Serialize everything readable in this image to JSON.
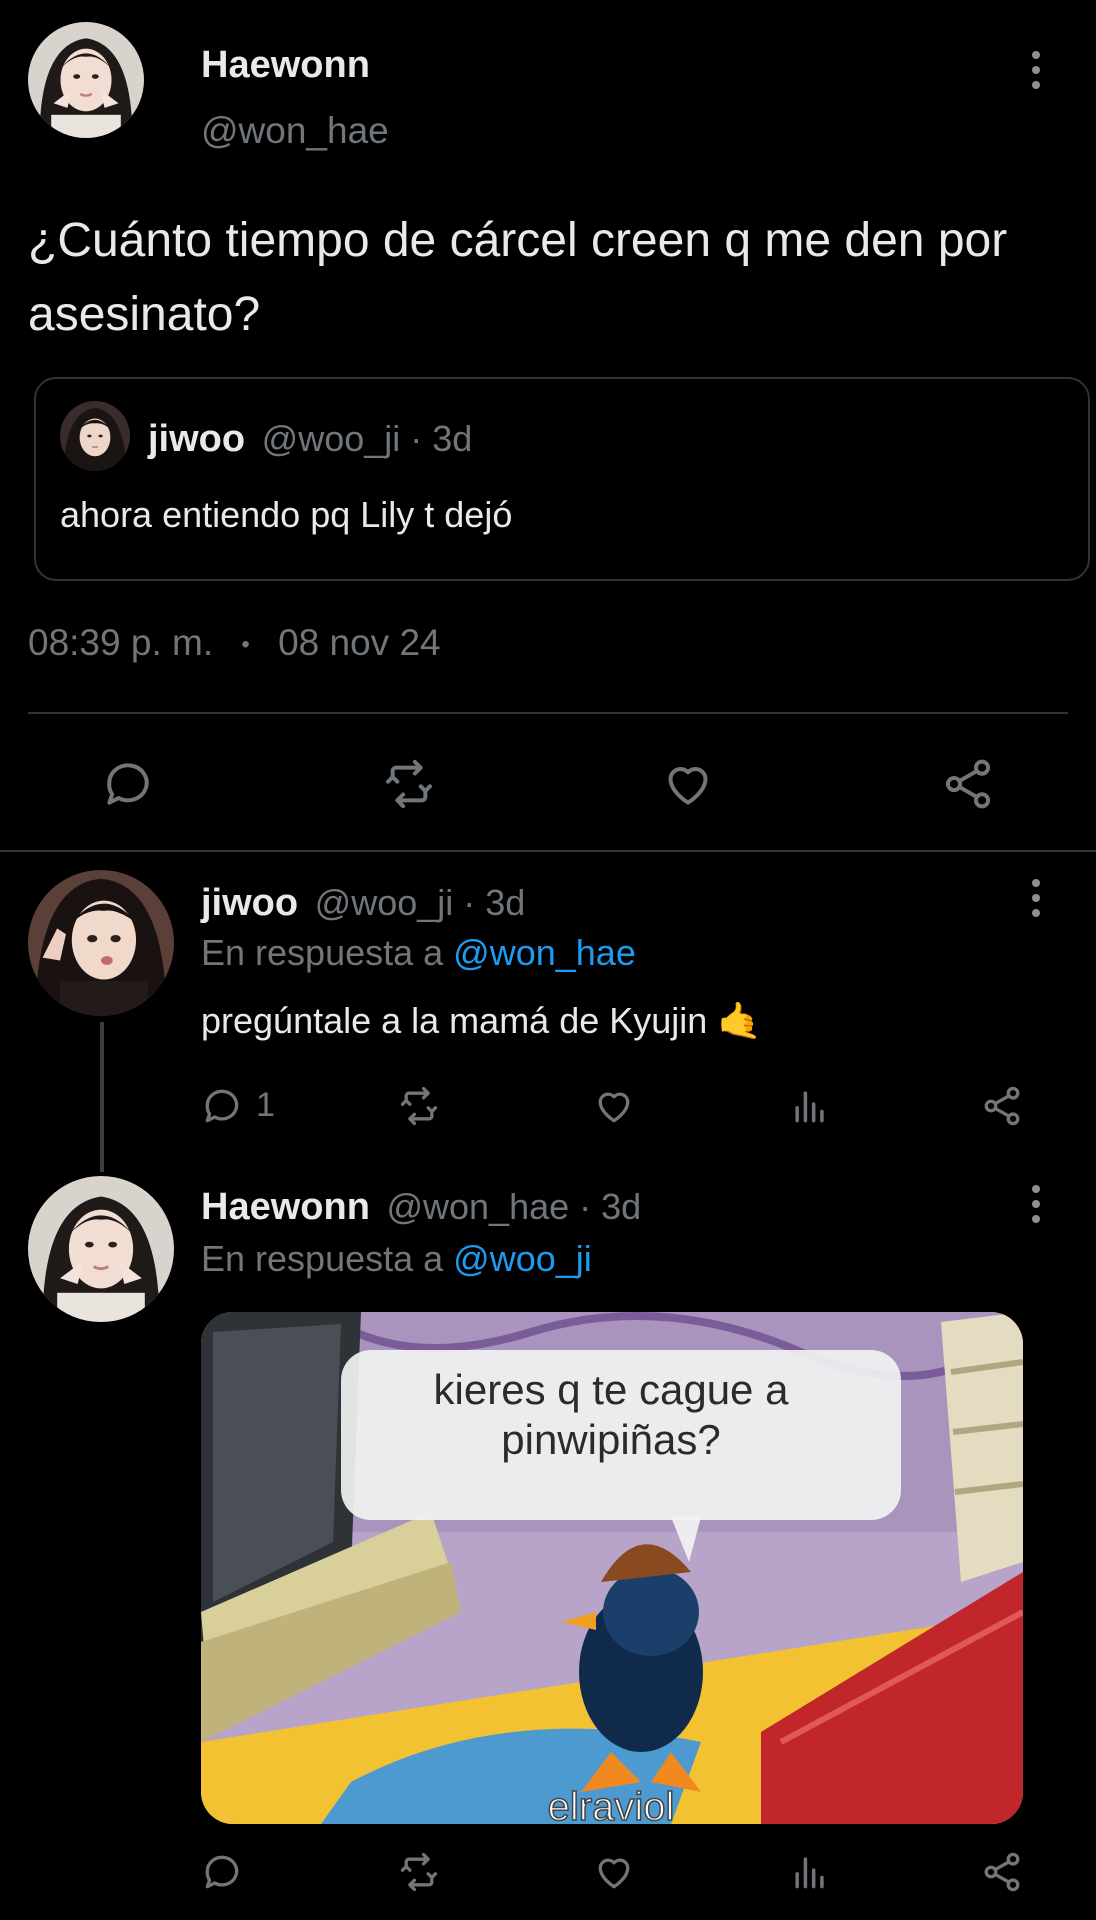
{
  "main_tweet": {
    "display_name": "Haewonn",
    "handle": "@won_hae",
    "text": "¿Cuánto tiempo de cárcel creen q me den por asesinato?",
    "quote": {
      "display_name": "jiwoo",
      "meta": "@woo_ji · 3d",
      "text": "ahora entiendo pq Lily t dejó"
    },
    "time": "08:39 p. m.",
    "separator": "•",
    "date": "08 nov 24"
  },
  "reply_1": {
    "display_name": "jiwoo",
    "meta": "@woo_ji · 3d",
    "reply_prefix": "En respuesta a ",
    "reply_handle": "@won_hae",
    "text": "pregúntale a la mamá de Kyujin",
    "emoji": "🤙",
    "reply_count": "1"
  },
  "reply_2": {
    "display_name": "Haewonn",
    "meta": "@won_hae · 3d",
    "reply_prefix": "En respuesta a ",
    "reply_handle": "@woo_ji",
    "image": {
      "bubble_line1": "kieres q te cague a",
      "bubble_line2": "pinwipiñas?",
      "watermark": "elraviol"
    }
  },
  "colors": {
    "background": "#000000",
    "text": "#e7e9ea",
    "muted": "#71767b",
    "link": "#1d9bf0",
    "divider": "#2f3336"
  },
  "icons": [
    "reply-icon",
    "retweet-icon",
    "like-icon",
    "share-icon",
    "views-icon",
    "more-icon"
  ]
}
